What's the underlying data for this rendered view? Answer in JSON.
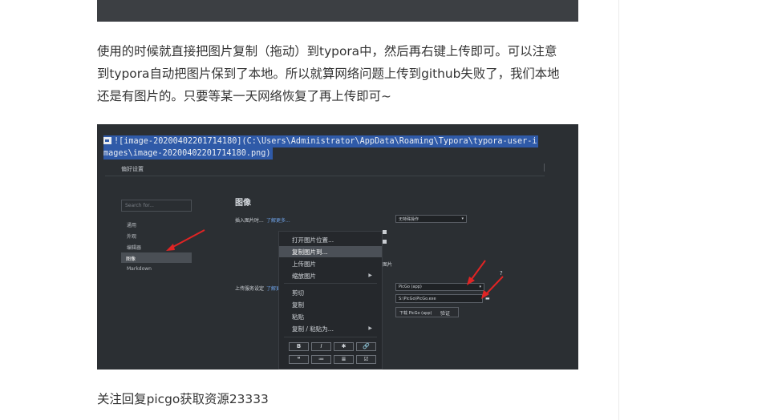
{
  "article": {
    "paragraph_lines": [
      "使用的时候就直接把图片复制（拖动）到typora中，然后再右键上传即可。可以注意",
      "到typora自动把图片保到了本地。所以就算网络问题上传到github失败了，我们本地",
      "还是有图片的。只要等某一天网络恢复了再上传即可~"
    ],
    "footer_text": "关注回复picgo获取资源23333"
  },
  "screenshot": {
    "code_line_1": "![image-20200402201714180](C:\\Users\\Administrator\\AppData\\Roaming\\Typora\\typora-user-i",
    "code_line_2": "mages\\image-20200402201714180.png)",
    "prefs_title": "偏好设置",
    "search_placeholder": "Search for...",
    "sidebar": [
      "通用",
      "外观",
      "编辑器",
      "图像",
      "Markdown"
    ],
    "section_title": "图像",
    "insert_label": "插入图片时...",
    "insert_link": "了解更多...",
    "insert_select": "无特殊操作",
    "upload_label": "上传服务设定",
    "upload_link": "了解更多",
    "upload_select": "PicGo (app)",
    "picgo_path": "S:\\PicGo\\PicGo.exe",
    "download_button": "下载 PicGo (app)",
    "verify_label": "验证",
    "help_icon": "?",
    "context_menu": [
      "打开图片位置...",
      "复制图片到...",
      "上传图片",
      "缩放图片",
      "剪切",
      "复制",
      "粘贴",
      "复制 / 粘贴为..."
    ],
    "format_buttons": [
      "B",
      "I",
      "✱",
      "🔗",
      "❝",
      "≔",
      "≣",
      "☑"
    ],
    "partial_texts": [
      "图片"
    ]
  },
  "colors": {
    "highlight": "#2f5aa8",
    "arrow_red": "#e02424",
    "dark_bg": "#2b2f33"
  }
}
